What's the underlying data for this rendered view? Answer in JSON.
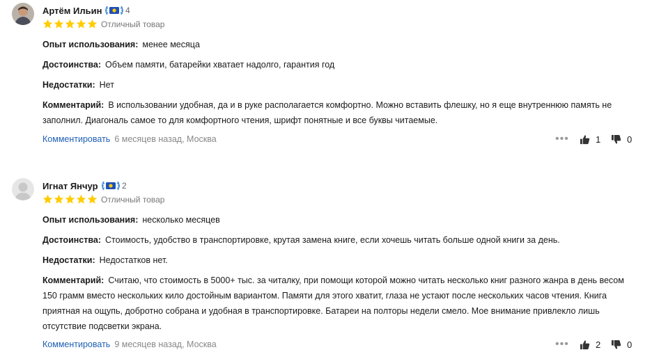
{
  "reviews": [
    {
      "author": "Артём Ильин",
      "badge_count": "4",
      "verdict": "Отличный товар",
      "rating": 5,
      "experience_label": "Опыт использования:",
      "experience": "менее месяца",
      "pros_label": "Достоинства:",
      "pros": "Объем памяти, батарейки хватает надолго, гарантия год",
      "cons_label": "Недостатки:",
      "cons": "Нет",
      "comment_label": "Комментарий:",
      "comment": "В использовании удобная, да и в руке располагается комфортно. Можно вставить флешку, но я еще внутреннюю память не заполнил. Диагональ самое то для комфортного чтения, шрифт понятные и все буквы читаемые.",
      "comment_link": "Комментировать",
      "meta": "6 месяцев назад, Москва",
      "likes": "1",
      "dislikes": "0"
    },
    {
      "author": "Игнат Янчур",
      "badge_count": "2",
      "verdict": "Отличный товар",
      "rating": 5,
      "experience_label": "Опыт использования:",
      "experience": "несколько месяцев",
      "pros_label": "Достоинства:",
      "pros": "Стоимость, удобство в транспортировке, крутая замена книге, если хочешь читать больше одной книги за день.",
      "cons_label": "Недостатки:",
      "cons": "Недостатков нет.",
      "comment_label": "Комментарий:",
      "comment": "Считаю, что стоимость в 5000+ тыс. за читалку, при помощи которой можно читать несколько книг разного жанра в день весом 150 грамм вместо нескольких кило достойным вариантом. Памяти для этого хватит, глаза не устают после нескольких часов чтения. Книга приятная на ощупь, добротно собрана и удобная в транспортировке. Батареи на полторы недели смело. Мое внимание привлекло лишь отсутствие подсветки экрана.",
      "comment_link": "Комментировать",
      "meta": "9 месяцев назад, Москва",
      "likes": "2",
      "dislikes": "0"
    }
  ],
  "colors": {
    "star": "#fc0",
    "link": "#1f5fb5",
    "badge_laurel": "#4a8fd6",
    "badge_center": "#2050b8",
    "badge_dot": "#fc0"
  },
  "icons": [
    "user-avatar",
    "laurel-badge-icon",
    "star-icon",
    "more-dots-icon",
    "thumbs-up-icon",
    "thumbs-down-icon"
  ]
}
